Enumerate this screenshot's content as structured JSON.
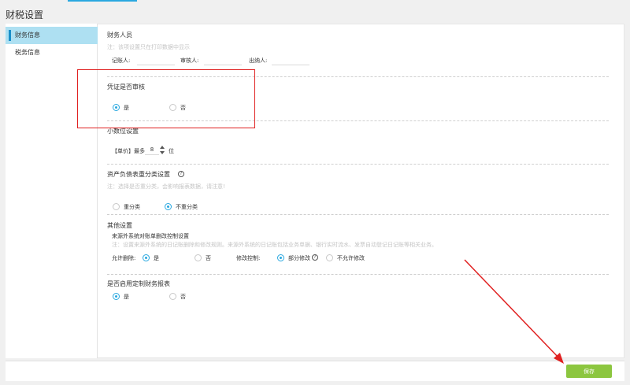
{
  "page": {
    "title": "财税设置"
  },
  "sidebar": {
    "items": [
      {
        "label": "财务信息"
      },
      {
        "label": "税务信息"
      }
    ]
  },
  "staff": {
    "title": "财务人员",
    "note": "注：该项设置只在打印数据中显示",
    "bookkeeper_label": "记账人:",
    "reviewer_label": "审核人:",
    "cashier_label": "出纳人:"
  },
  "voucher_review": {
    "title": "凭证是否审核",
    "yes": "是",
    "no": "否"
  },
  "decimal": {
    "title": "小数位设置",
    "prefix": "【单价】最多",
    "value": "8",
    "suffix": "位"
  },
  "balance_sheet": {
    "title": "资产负债表重分类设置",
    "note": "注：选择是否重分类，会影响报表数据，请注意!",
    "opt_reclass": "重分类",
    "opt_no_reclass": "不重分类"
  },
  "other": {
    "title": "其他设置",
    "subtitle": "来源外系统对账单删改控制设置",
    "note": "注：设置来源外系统的日记账删除和修改规则。来源外系统的日记账包括业务单据、银行实时流水、发票自动登记日记账等相关业务。",
    "allow_delete_label": "允许删除:",
    "yes": "是",
    "no": "否",
    "modify_label": "修改控制:",
    "partial": "部分修改",
    "disallow": "不允许修改"
  },
  "custom_report": {
    "title": "是否启用定制财务报表",
    "yes": "是",
    "no": "否"
  },
  "footer": {
    "save_label": "保存"
  },
  "colors": {
    "accent": "#29a8e0",
    "save": "#8cc63f",
    "annotation": "#e02020",
    "sidebar_active": "#aee0f2"
  },
  "icons": {
    "help": "question-circle-icon"
  }
}
